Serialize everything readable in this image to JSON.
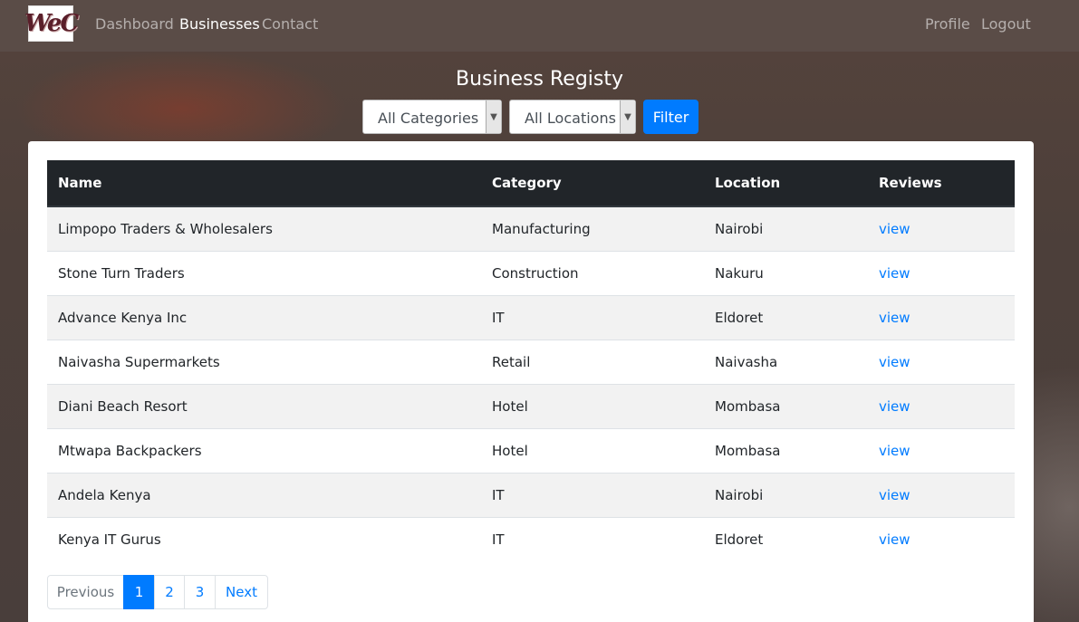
{
  "nav": {
    "brand_text": "WeC",
    "links": [
      "Dashboard",
      "Businesses",
      "Contact"
    ],
    "right_links": [
      "Profile",
      "Logout"
    ]
  },
  "page": {
    "title": "Business Registy"
  },
  "filters": {
    "category_selected": "All Categories",
    "location_selected": "All Locations",
    "button_label": "Filter"
  },
  "table": {
    "headers": [
      "Name",
      "Category",
      "Location",
      "Reviews"
    ],
    "rows": [
      {
        "name": "Limpopo Traders & Wholesalers",
        "category": "Manufacturing",
        "location": "Nairobi",
        "reviews": "view"
      },
      {
        "name": "Stone Turn Traders",
        "category": "Construction",
        "location": "Nakuru",
        "reviews": "view"
      },
      {
        "name": "Advance Kenya Inc",
        "category": "IT",
        "location": "Eldoret",
        "reviews": "view"
      },
      {
        "name": "Naivasha Supermarkets",
        "category": "Retail",
        "location": "Naivasha",
        "reviews": "view"
      },
      {
        "name": "Diani Beach Resort",
        "category": "Hotel",
        "location": "Mombasa",
        "reviews": "view"
      },
      {
        "name": "Mtwapa Backpackers",
        "category": "Hotel",
        "location": "Mombasa",
        "reviews": "view"
      },
      {
        "name": "Andela Kenya",
        "category": "IT",
        "location": "Nairobi",
        "reviews": "view"
      },
      {
        "name": "Kenya IT Gurus",
        "category": "IT",
        "location": "Eldoret",
        "reviews": "view"
      }
    ]
  },
  "pagination": {
    "previous": "Previous",
    "pages": [
      "1",
      "2",
      "3"
    ],
    "active_page": "1",
    "next": "Next"
  },
  "colors": {
    "primary": "#007bff",
    "navbar": "#5a4c47",
    "table_header": "#212529"
  }
}
